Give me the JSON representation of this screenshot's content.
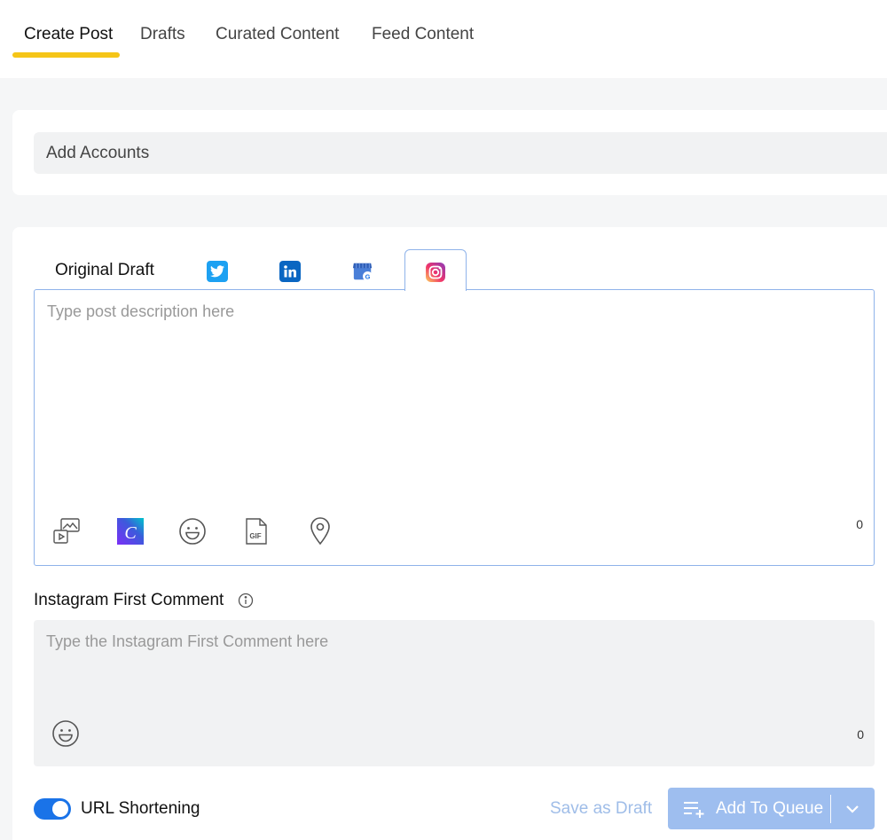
{
  "nav": {
    "tabs": [
      {
        "label": "Create Post",
        "active": true
      },
      {
        "label": "Drafts",
        "active": false
      },
      {
        "label": "Curated Content",
        "active": false
      },
      {
        "label": "Feed Content",
        "active": false
      }
    ]
  },
  "accounts": {
    "label": "Add Accounts"
  },
  "post_tabs": {
    "original_label": "Original Draft",
    "networks": [
      "twitter-icon",
      "linkedin-icon",
      "google-business-icon",
      "instagram-icon"
    ],
    "active": "instagram"
  },
  "description": {
    "placeholder": "Type post description here",
    "char_count": "0",
    "toolbar": [
      "media-icon",
      "canva-icon",
      "emoji-icon",
      "gif-icon",
      "location-icon"
    ]
  },
  "first_comment": {
    "label": "Instagram First Comment",
    "placeholder": "Type the Instagram First Comment here",
    "char_count": "0"
  },
  "footer": {
    "url_shortening_label": "URL Shortening",
    "url_shortening_on": true,
    "save_draft_label": "Save as Draft",
    "add_to_queue_label": "Add To Queue"
  },
  "colors": {
    "accent": "#f5c518",
    "primary": "#1a73e8",
    "twitter": "#1da1f2",
    "linkedin": "#0a66c2"
  }
}
